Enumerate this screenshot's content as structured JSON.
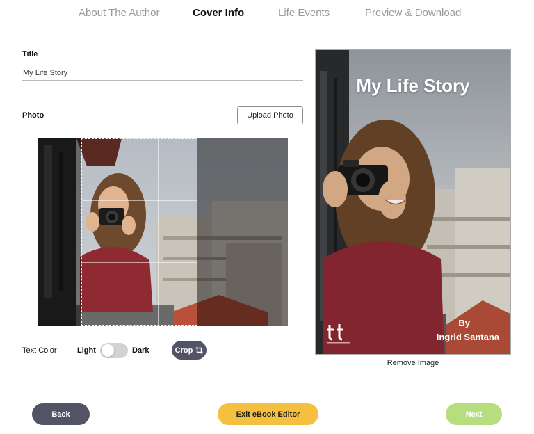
{
  "tabs": [
    {
      "label": "About The Author",
      "active": false
    },
    {
      "label": "Cover Info",
      "active": true
    },
    {
      "label": "Life Events",
      "active": false
    },
    {
      "label": "Preview & Download",
      "active": false
    }
  ],
  "form": {
    "title_label": "Title",
    "title_value": "My Life Story",
    "photo_label": "Photo",
    "upload_button": "Upload Photo"
  },
  "text_color": {
    "label": "Text Color",
    "light_label": "Light",
    "dark_label": "Dark",
    "selected": "Light"
  },
  "crop_button": "Crop",
  "cover": {
    "title": "My Life Story",
    "by_label": "By",
    "author": "Ingrid Santana",
    "logo_text": "tt"
  },
  "remove_image": "Remove Image",
  "nav": {
    "back": "Back",
    "exit": "Exit eBook Editor",
    "next": "Next"
  },
  "colors": {
    "dark_button": "#525466",
    "exit_button": "#f5bf40",
    "next_button": "#b6de7e",
    "tab_inactive": "#9a9a9a"
  },
  "icons": {
    "crop": "crop-icon",
    "logo": "brand-logo-icon"
  }
}
